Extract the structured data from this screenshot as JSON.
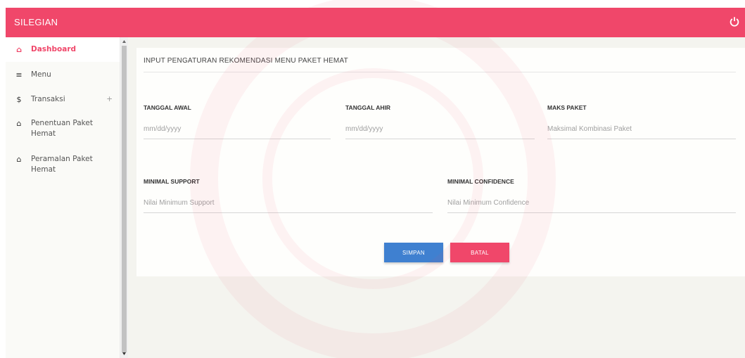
{
  "app": {
    "title": "SILEGIAN"
  },
  "colors": {
    "accent": "#f0476a",
    "primary": "#3f80d0"
  },
  "sidebar": {
    "items": [
      {
        "label": "Dashboard",
        "icon": "home-icon",
        "active": true
      },
      {
        "label": "Menu",
        "icon": "hamburger-icon"
      },
      {
        "label": "Transaksi",
        "icon": "dollar-icon",
        "expand": "+"
      },
      {
        "label": "Penentuan Paket Hemat",
        "icon": "home-icon"
      },
      {
        "label": "Peramalan Paket Hemat",
        "icon": "home-icon"
      }
    ]
  },
  "form": {
    "title": "INPUT PENGATURAN REKOMENDASI MENU PAKET HEMAT",
    "tanggal_awal": {
      "label": "TANGGAL AWAL",
      "placeholder": "mm/dd/yyyy"
    },
    "tanggal_ahir": {
      "label": "TANGGAL AHIR",
      "placeholder": "mm/dd/yyyy"
    },
    "maks_paket": {
      "label": "MAKS PAKET",
      "placeholder": "Maksimal Kombinasi Paket"
    },
    "minimal_support": {
      "label": "MINIMAL SUPPORT",
      "placeholder": "Nilai Minimum Support"
    },
    "minimal_confidence": {
      "label": "MINIMAL CONFIDENCE",
      "placeholder": "Nilai Minimum Confidence"
    },
    "save_label": "SIMPAN",
    "cancel_label": "BATAL"
  }
}
